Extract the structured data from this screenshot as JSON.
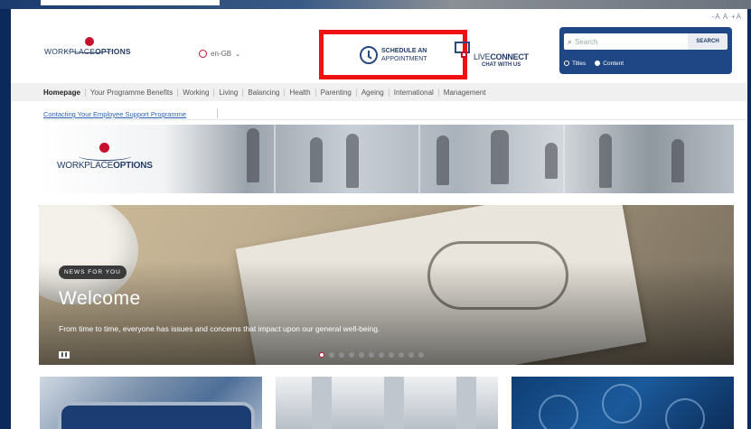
{
  "font_sizes": "-A  A  +A",
  "brand": {
    "logo_light": "WORKPLACE",
    "logo_bold": "OPTIONS",
    "accent_color": "#c8102e",
    "navy_color": "#1f4785"
  },
  "language": {
    "value": "en-GB"
  },
  "schedule": {
    "line1": "SCHEDULE AN",
    "line2": "APPOINTMENT",
    "highlight_color": "#ee1111"
  },
  "liveconnect": {
    "live": "LIVE",
    "connect": "CONNECT",
    "sub": "CHAT WITH US"
  },
  "search": {
    "placeholder": "Search",
    "button": "SEARCH",
    "opt_titles": "Titles",
    "opt_content": "Content"
  },
  "nav": {
    "items": [
      "Homepage",
      "Your Programme Benefits",
      "Working",
      "Living",
      "Balancing",
      "Health",
      "Parenting",
      "Ageing",
      "International",
      "Management"
    ]
  },
  "subnav": {
    "link": "Contacting Your Employee Support Programme"
  },
  "hero": {
    "badge": "NEWS FOR YOU",
    "title": "Welcome",
    "text": "From time to time, everyone has issues and concerns that impact upon our general well-being.",
    "pause_icon": "pause-icon",
    "slide_count": 11,
    "active_slide": 0
  }
}
